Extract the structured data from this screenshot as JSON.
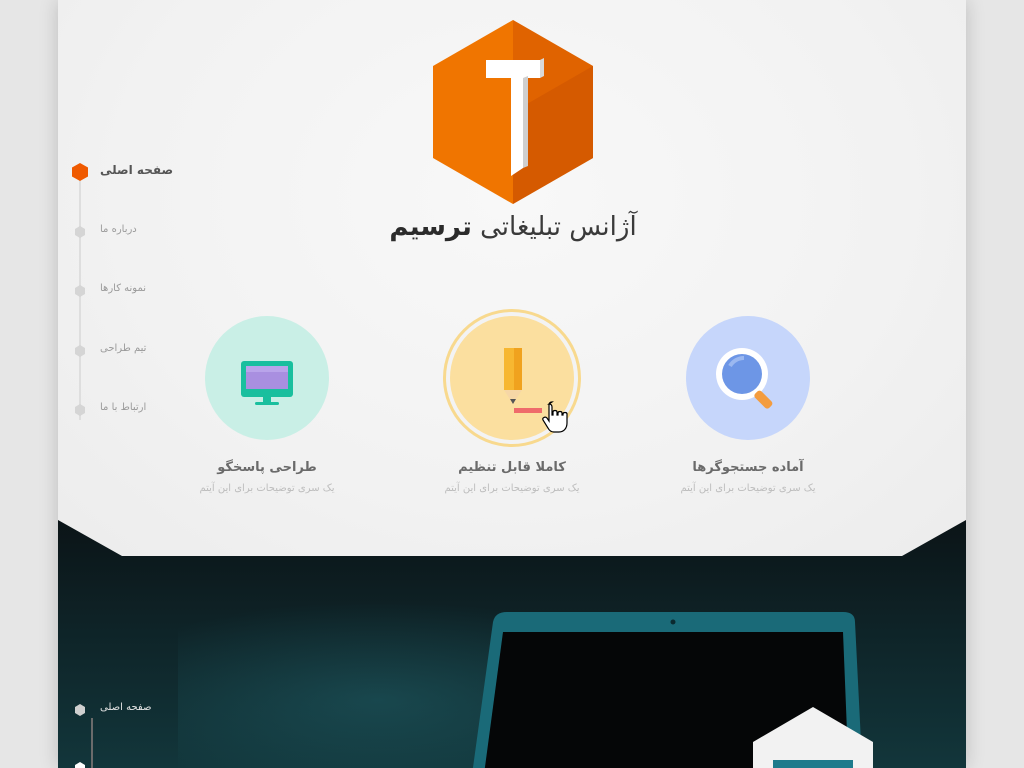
{
  "brand": {
    "prefix": "آژانس تبلیغاتی",
    "name": "ترسیم",
    "logo_letter": "T"
  },
  "colors": {
    "accent": "#ef6a00",
    "accent_dark": "#c94f00",
    "teal_circle": "#c9efe6",
    "yellow_circle": "#fbdf9f",
    "blue_circle": "#c6d6fb"
  },
  "sidenav": {
    "items": [
      {
        "label": "صفحه اصلی",
        "active": true
      },
      {
        "label": "درباره ما"
      },
      {
        "label": "نمونه کارها"
      },
      {
        "label": "تیم طراحی"
      },
      {
        "label": "ارتباط با ما"
      }
    ]
  },
  "features": [
    {
      "icon": "monitor-icon",
      "title": "طراحی پاسخگو",
      "desc": "یک سری توضیحات برای این آیتم"
    },
    {
      "icon": "pencil-icon",
      "title": "کاملا قابل تنظیم",
      "desc": "یک سری توضیحات برای این آیتم"
    },
    {
      "icon": "magnifier-icon",
      "title": "آماده جستجوگرها",
      "desc": "یک سری توضیحات برای این آیتم"
    }
  ],
  "dark_section": {
    "nav_first_label": "صفحه اصلی"
  }
}
